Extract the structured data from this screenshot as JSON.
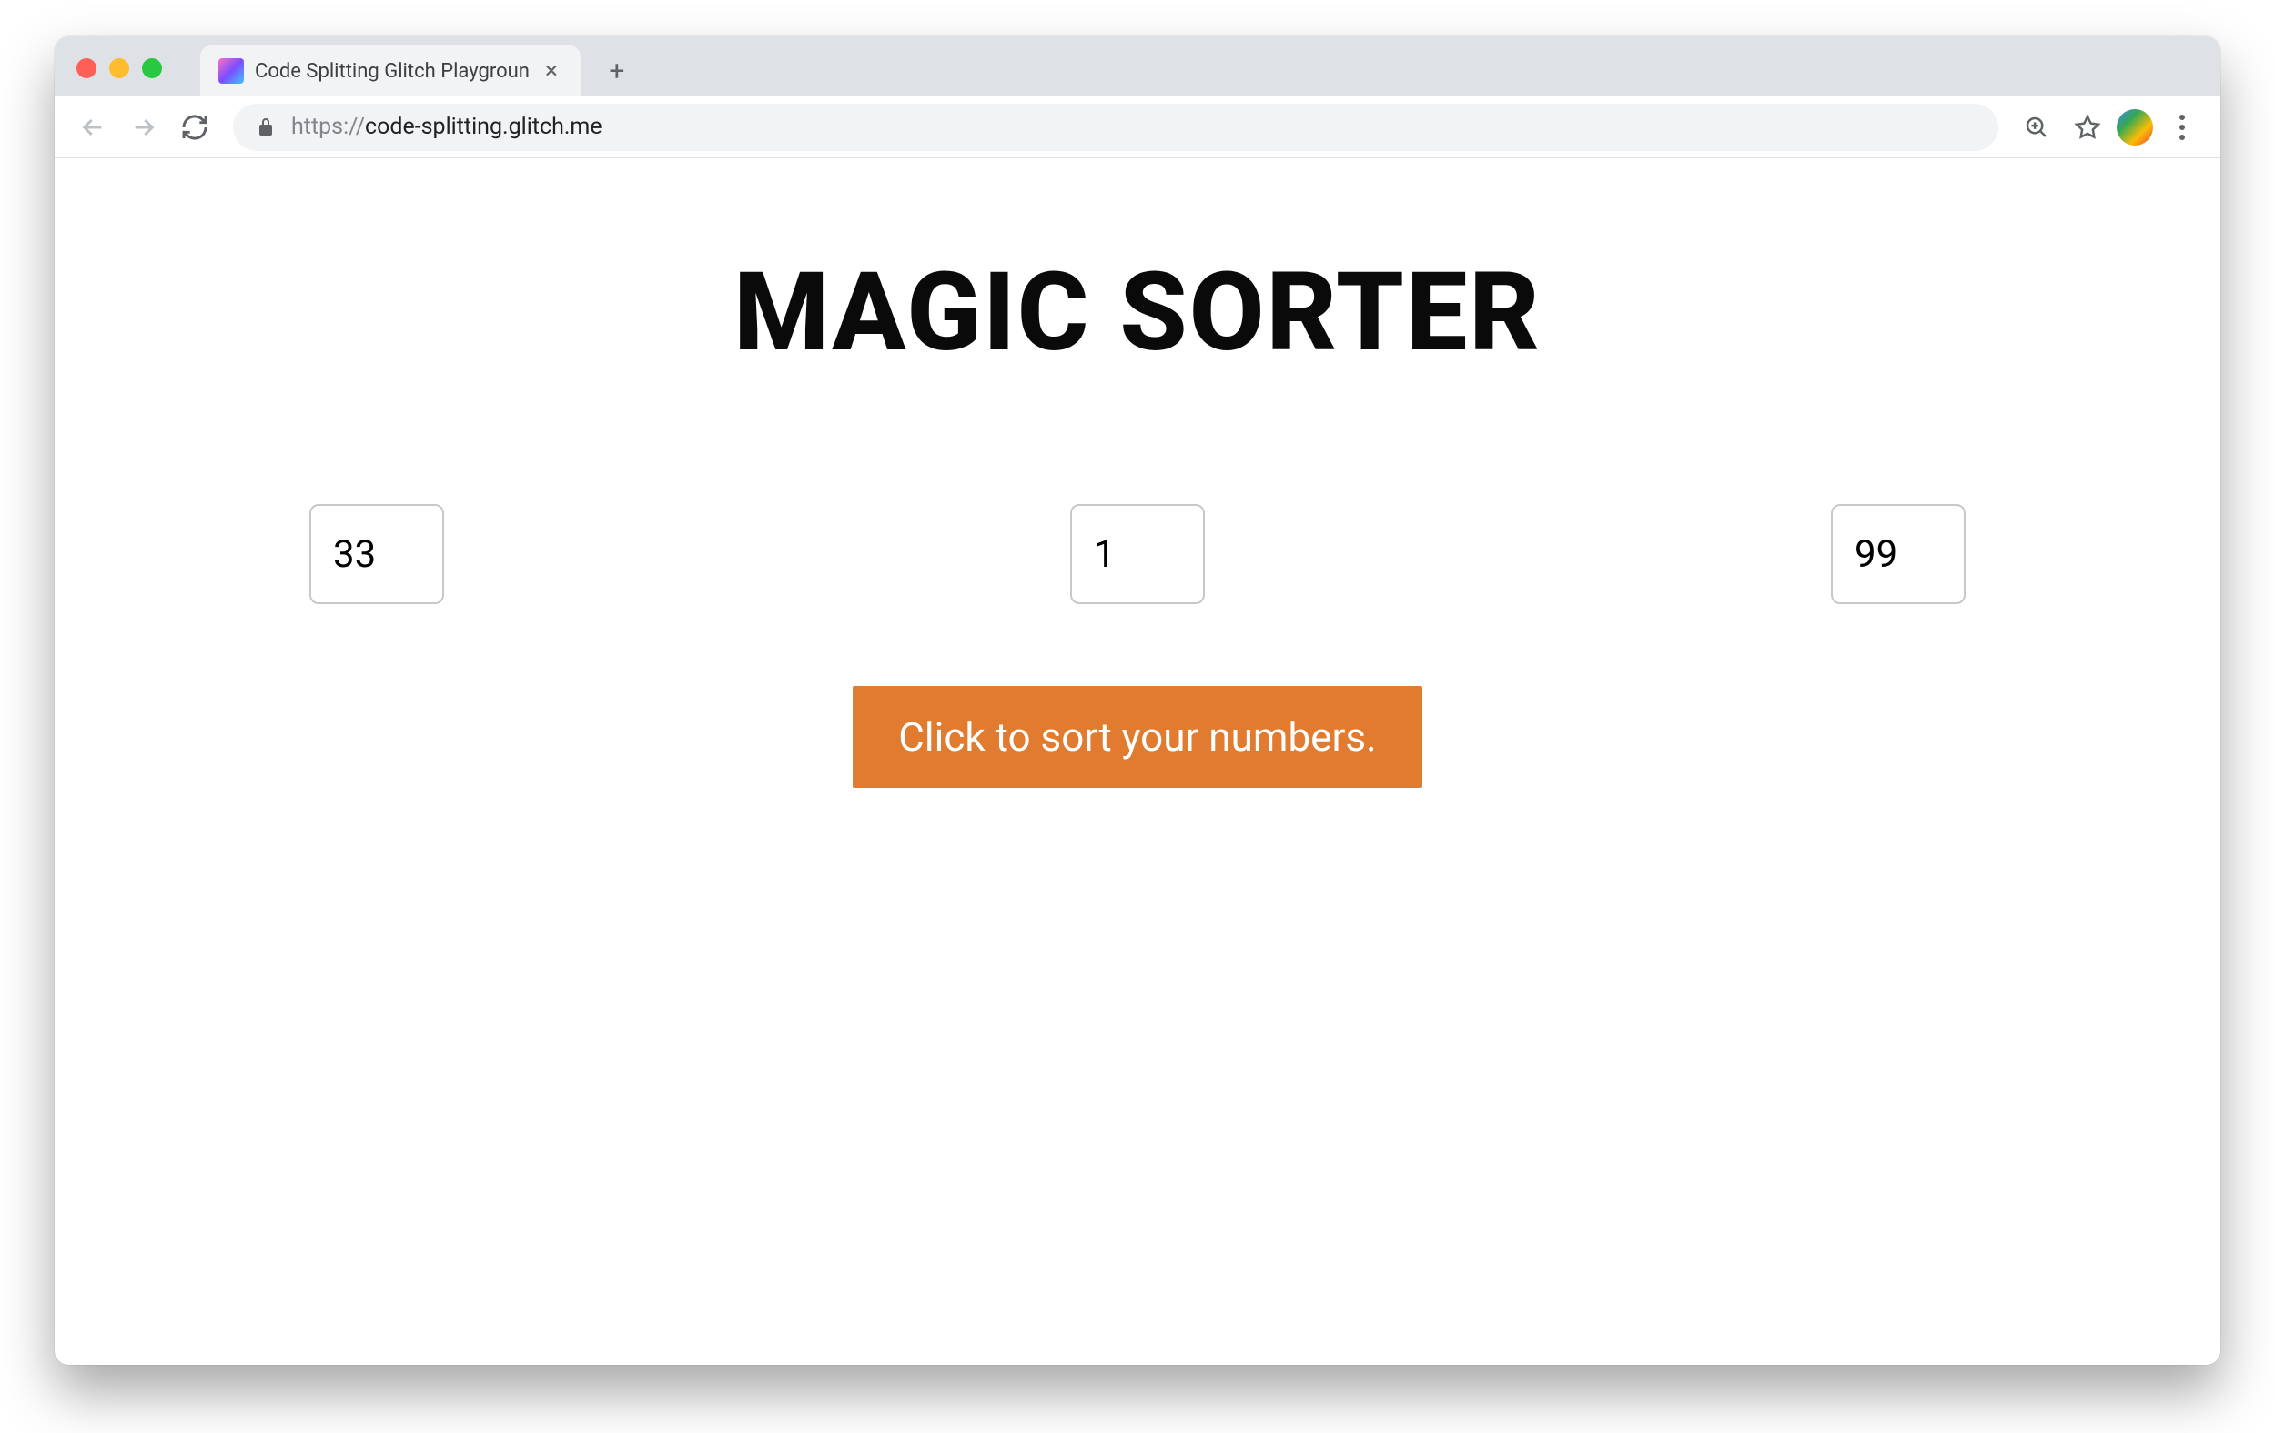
{
  "browser": {
    "tab": {
      "title": "Code Splitting Glitch Playgroun"
    },
    "url": {
      "protocol": "https://",
      "host": "code-splitting.glitch.me"
    }
  },
  "page": {
    "title": "MAGIC SORTER",
    "inputs": {
      "a": "33",
      "b": "1",
      "c": "99"
    },
    "button_label": "Click to sort your numbers."
  },
  "colors": {
    "accent": "#e07b2f"
  }
}
